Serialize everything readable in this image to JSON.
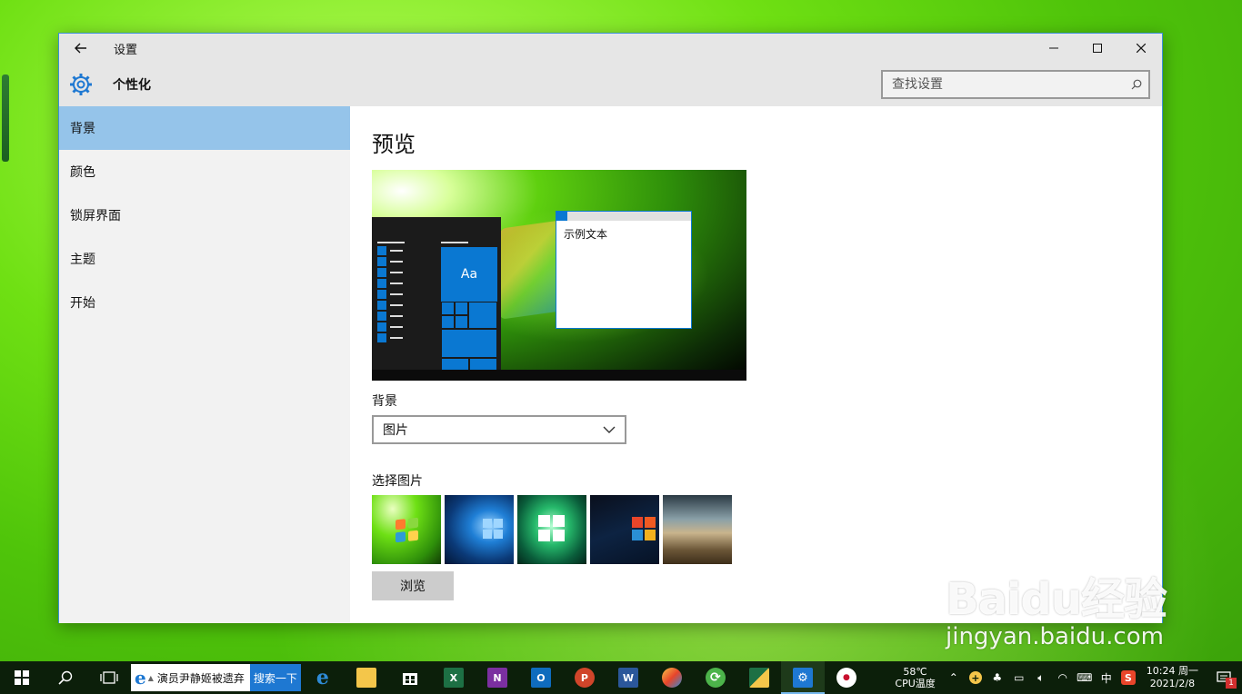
{
  "window": {
    "title": "设置",
    "page_title": "个性化",
    "search_placeholder": "查找设置"
  },
  "sidebar": {
    "items": [
      {
        "label": "背景",
        "active": true
      },
      {
        "label": "颜色",
        "active": false
      },
      {
        "label": "锁屏界面",
        "active": false
      },
      {
        "label": "主题",
        "active": false
      },
      {
        "label": "开始",
        "active": false
      }
    ]
  },
  "content": {
    "preview_title": "预览",
    "sample_text": "示例文本",
    "tile_text": "Aa",
    "background_label": "背景",
    "background_value": "图片",
    "choose_picture_label": "选择图片",
    "browse_label": "浏览"
  },
  "taskbar": {
    "ie_text": "演员尹静姬被遗弃",
    "ie_go": "搜索一下",
    "cpu_temp": "58℃",
    "cpu_label": "CPU温度",
    "ime": "中",
    "time": "10:24 周一",
    "date": "2021/2/8",
    "notification_count": "1"
  },
  "watermark": {
    "logo": "Baidu经验",
    "url": "jingyan.baidu.com"
  },
  "colors": {
    "accent": "#0a78d2",
    "sidebar_active": "#95c4ea",
    "window_border": "#3b8fd6"
  }
}
